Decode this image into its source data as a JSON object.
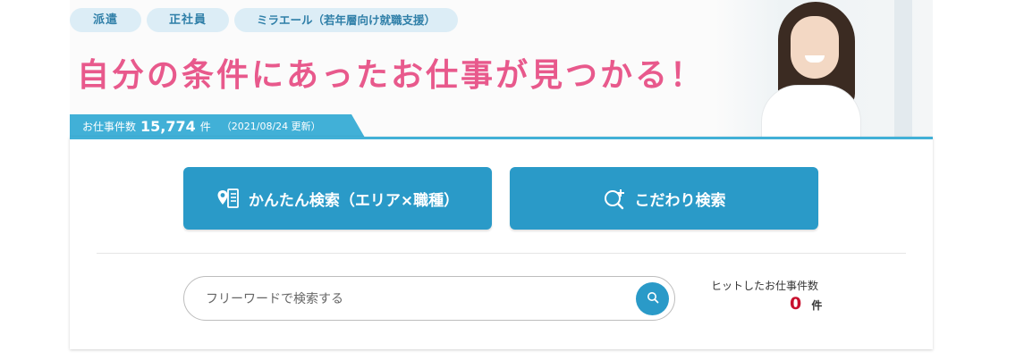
{
  "tabs": [
    {
      "label": "派遣"
    },
    {
      "label": "正社員"
    },
    {
      "label": "ミラエール（若年層向け就職支援）"
    }
  ],
  "headline": "自分の条件にあったお仕事が見つかる！",
  "job_count": {
    "label": "お仕事件数",
    "value": "15,774",
    "unit": "件",
    "updated": "（2021/08/24 更新）"
  },
  "buttons": {
    "easy_search": {
      "label": "かんたん検索（エリア×職種）",
      "icon": "map-pin-list-icon"
    },
    "detail_search": {
      "label": "こだわり検索",
      "icon": "search-plus-icon"
    }
  },
  "search": {
    "placeholder": "フリーワードで検索する",
    "value": "",
    "button_icon": "search-icon"
  },
  "hits": {
    "label": "ヒットしたお仕事件数",
    "value": "0",
    "unit": "件"
  },
  "colors": {
    "accent_blue": "#2a9ac8",
    "bar_blue": "#41b0d7",
    "headline_pink": "#e8598c",
    "tab_bg": "#dcedf6",
    "hit_red": "#c8102e"
  }
}
